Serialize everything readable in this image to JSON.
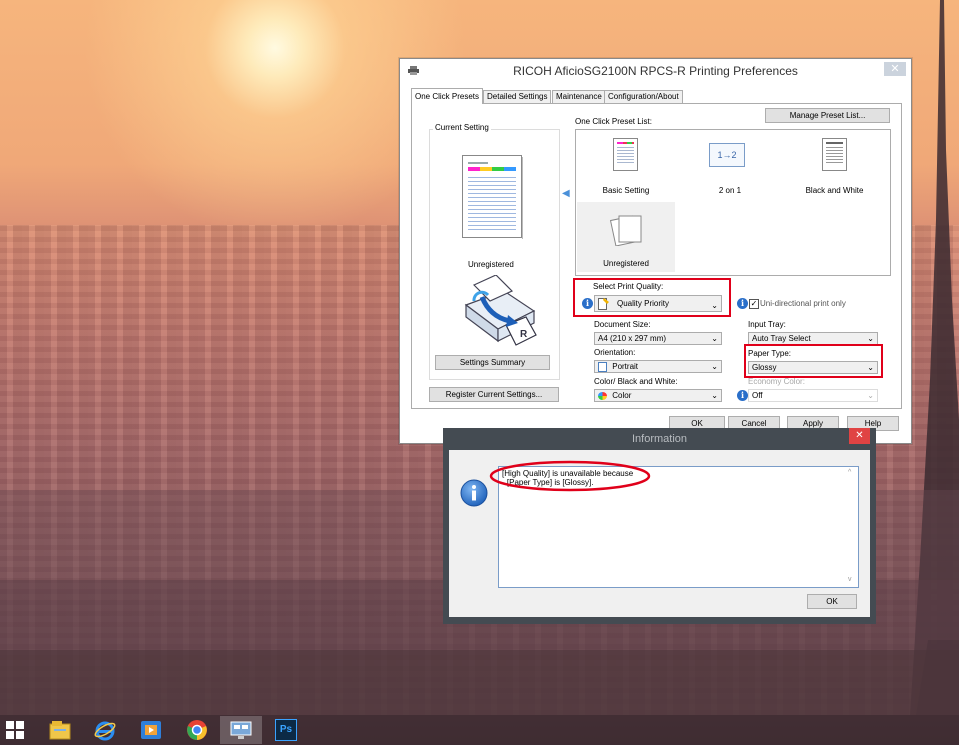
{
  "window": {
    "title": "RICOH AficioSG2100N RPCS-R Printing Preferences",
    "close": "✕",
    "tabs": [
      "One Click Presets",
      "Detailed Settings",
      "Maintenance",
      "Configuration/About"
    ]
  },
  "left": {
    "current_setting_label": "Current Setting",
    "unregistered": "Unregistered",
    "settings_summary": "Settings Summary",
    "register_button": "Register Current Settings..."
  },
  "presets": {
    "list_label": "One Click Preset List:",
    "manage_button": "Manage Preset List...",
    "items": [
      "Basic Setting",
      "2 on 1",
      "Black and White",
      "Unregistered"
    ],
    "two_on_one_icon_text": "1→2"
  },
  "settings": {
    "print_quality_label": "Select Print Quality:",
    "print_quality_value": "Quality Priority",
    "unidirectional_label": "Uni-directional print only",
    "document_size_label": "Document Size:",
    "document_size_value": "A4 (210 x 297 mm)",
    "input_tray_label": "Input Tray:",
    "input_tray_value": "Auto Tray Select",
    "orientation_label": "Orientation:",
    "orientation_value": "Portrait",
    "paper_type_label": "Paper Type:",
    "paper_type_value": "Glossy",
    "color_label": "Color/ Black and White:",
    "color_value": "Color",
    "economy_label": "Economy Color:",
    "economy_value": "Off"
  },
  "buttons": {
    "ok": "OK",
    "cancel": "Cancel",
    "apply": "Apply",
    "help": "Help"
  },
  "dialog": {
    "title": "Information",
    "close": "✕",
    "message_line1": "[High Quality] is unavailable because",
    "message_line2": "- [Paper Type] is [Glossy].",
    "ok": "OK",
    "info_glyph": "i"
  },
  "taskbar": {
    "ps_label": "Ps",
    "icons": [
      "windows-start-icon",
      "file-explorer-icon",
      "internet-explorer-icon",
      "media-player-icon",
      "chrome-icon",
      "remote-desktop-icon",
      "photoshop-icon"
    ]
  },
  "colors": {
    "highlight_red": "#e0001a",
    "dialog_frame": "#444b52",
    "info_blue": "#2a6fc9"
  }
}
